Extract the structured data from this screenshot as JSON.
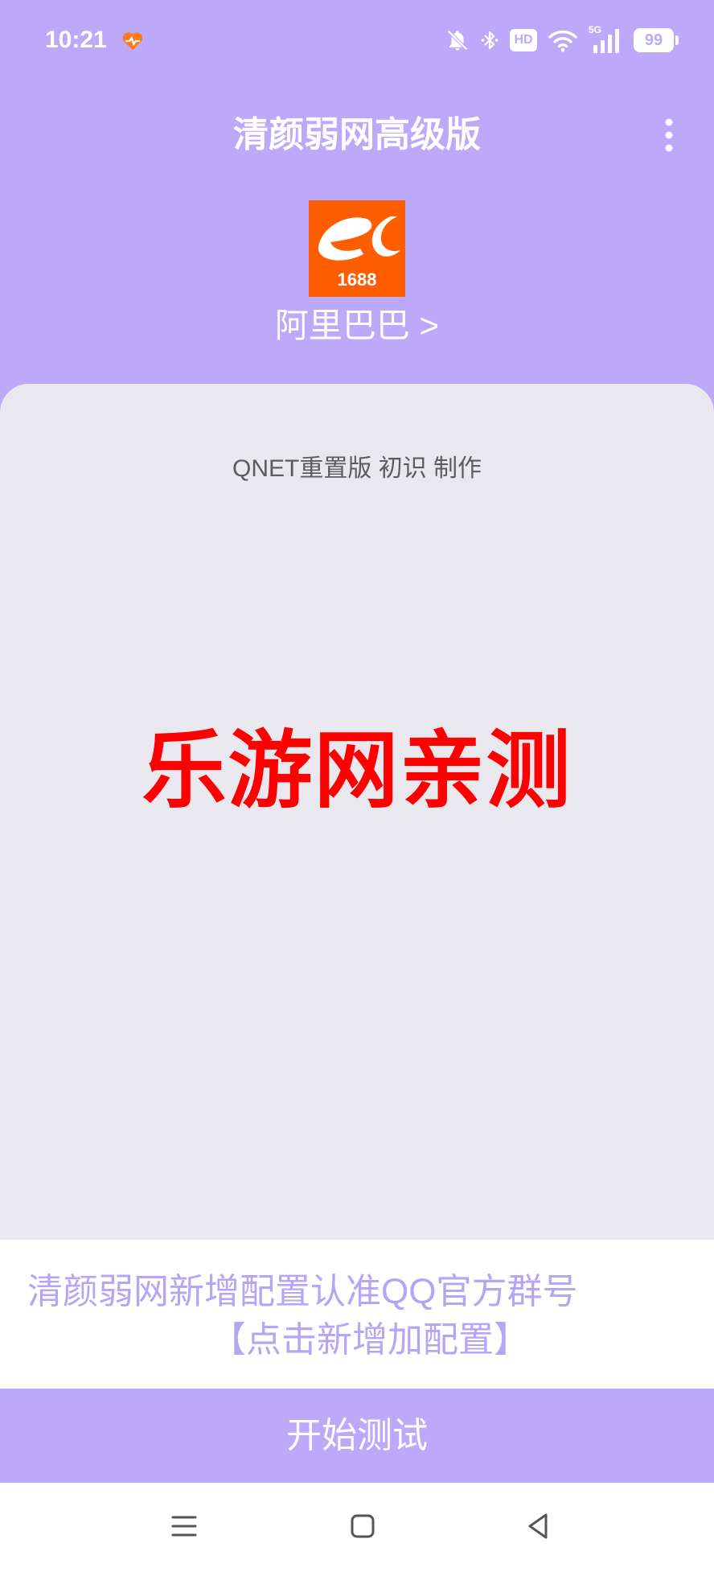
{
  "status_bar": {
    "time": "10:21",
    "hd_label": "HD",
    "network_label": "5G",
    "battery_level": "99",
    "icons": [
      "heart-app-icon",
      "bell-mute-icon",
      "bluetooth-icon",
      "hd-icon",
      "wifi-icon",
      "signal-5g-icon",
      "battery-icon"
    ]
  },
  "header": {
    "title": "清颜弱网高级版",
    "menu_icon": "more-vertical-icon"
  },
  "selected_app": {
    "logo_text": "1688",
    "name": "阿里巴巴 >"
  },
  "card": {
    "credit": "QNET重置版 初识 制作",
    "watermark": "乐游网亲测"
  },
  "notice": {
    "line1": "清颜弱网新增配置认准QQ官方群号",
    "line2": "【点击新增加配置】"
  },
  "start_button": {
    "label": "开始测试"
  },
  "nav_bar": {
    "icons": [
      "menu-icon",
      "home-icon",
      "back-icon"
    ]
  },
  "colors": {
    "primary": "#BCA9FA",
    "card_bg": "#E9E8EE",
    "notice_text": "#B6A4F5",
    "watermark": "#FF0000",
    "logo_bg": "#FF5E00"
  }
}
